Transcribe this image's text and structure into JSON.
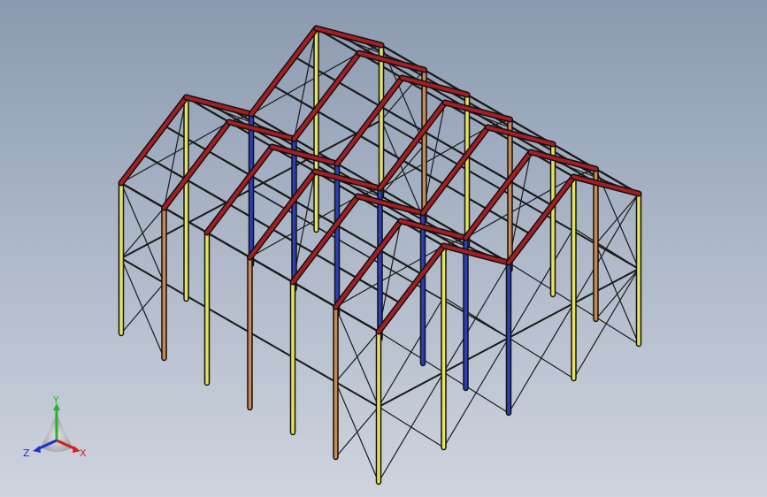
{
  "viewport": {
    "background_top": "#8b9ab0",
    "background_bottom": "#cfd4de"
  },
  "colors": {
    "beam_outline": "#101010",
    "column_yellow": "#e8e35a",
    "column_orange": "#c98a52",
    "column_blue": "#2b3fb8",
    "rafter_red": "#a61e22",
    "purlin": "#1a1a1a"
  },
  "triad": {
    "x_label": "X",
    "y_label": "Y",
    "z_label": "Z",
    "x_color": "#d42020",
    "y_color": "#28b428",
    "z_color": "#2030d0",
    "icon": "coordinate-triad-icon"
  }
}
